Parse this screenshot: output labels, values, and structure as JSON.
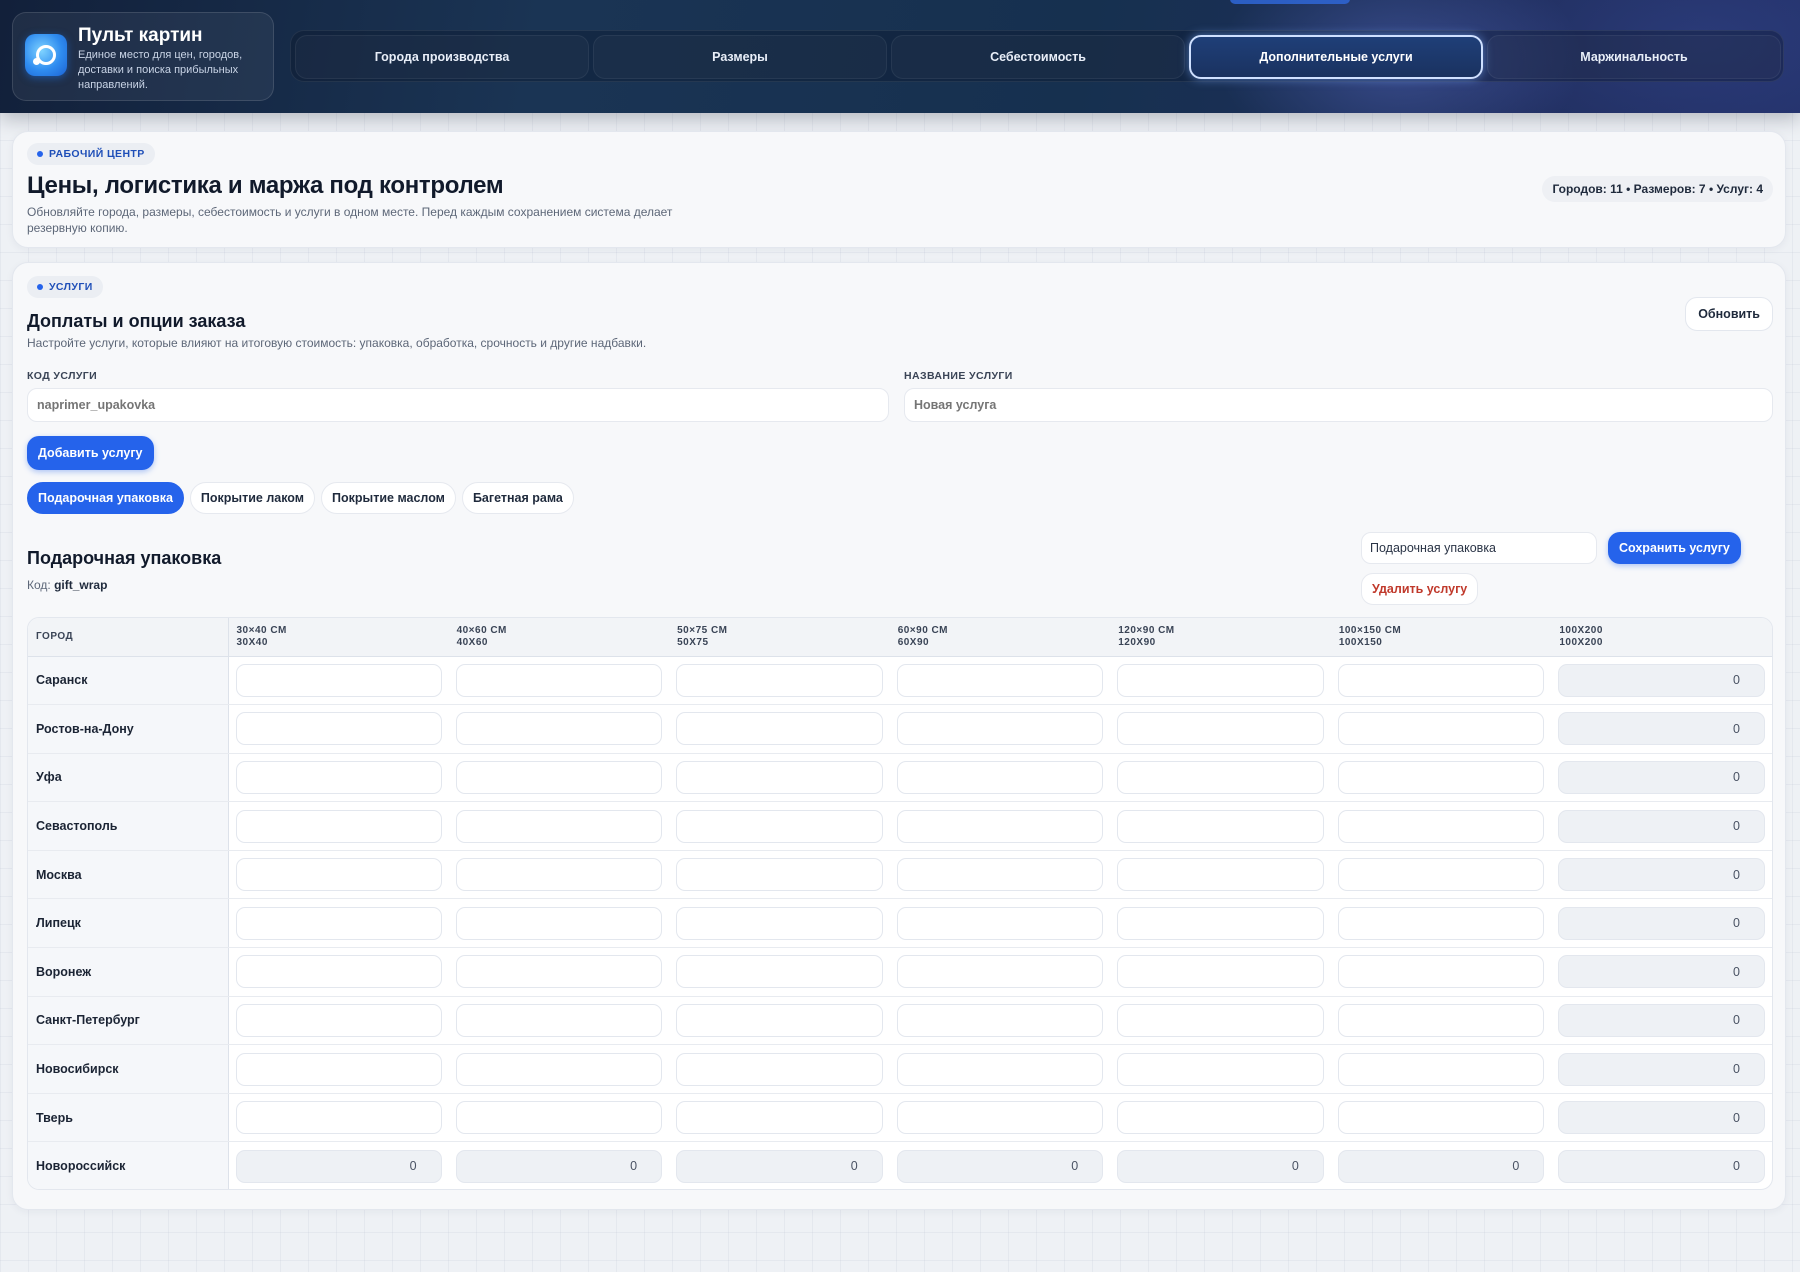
{
  "app": {
    "title": "Пульт картин",
    "subtitle": "Единое место для цен, городов, доставки и поиска прибыльных направлений."
  },
  "nav": {
    "tabs": [
      {
        "label": "Города производства",
        "active": false
      },
      {
        "label": "Размеры",
        "active": false
      },
      {
        "label": "Себестоимость",
        "active": false
      },
      {
        "label": "Дополнительные услуги",
        "active": true
      },
      {
        "label": "Маржинальность",
        "active": false
      }
    ]
  },
  "hero": {
    "tag": "РАБОЧИЙ ЦЕНТР",
    "title": "Цены, логистика и маржа под контролем",
    "description": "Обновляйте города, размеры, себестоимость и услуги в одном месте. Перед каждым сохранением система делает резервную копию.",
    "stats": "Городов: 11 • Размеров: 7 • Услуг: 4"
  },
  "services": {
    "tag": "УСЛУГИ",
    "title": "Доплаты и опции заказа",
    "description": "Настройте услуги, которые влияют на итоговую стоимость: упаковка, обработка, срочность и другие надбавки.",
    "refresh_label": "Обновить",
    "code_label": "КОД УСЛУГИ",
    "code_placeholder": "naprimer_upakovka",
    "name_label": "НАЗВАНИЕ УСЛУГИ",
    "name_placeholder": "Новая услуга",
    "add_label": "Добавить услугу",
    "tabs": [
      "Подарочная упаковка",
      "Покрытие лаком",
      "Покрытие маслом",
      "Багетная рама"
    ],
    "active_tab": 0
  },
  "selected": {
    "name": "Подарочная упаковка",
    "code_prefix": "Код:",
    "code": "gift_wrap",
    "edit_value": "Подарочная упаковка",
    "save_label": "Сохранить услугу",
    "delete_label": "Удалить услугу"
  },
  "table": {
    "city_header": "ГОРОД",
    "sizes": [
      {
        "label": "30×40 СМ",
        "code": "30X40"
      },
      {
        "label": "40×60 СМ",
        "code": "40X60"
      },
      {
        "label": "50×75 СМ",
        "code": "50X75"
      },
      {
        "label": "60×90 СМ",
        "code": "60X90"
      },
      {
        "label": "120×90 СМ",
        "code": "120X90"
      },
      {
        "label": "100×150 СМ",
        "code": "100X150"
      },
      {
        "label": "100X200",
        "code": "100X200"
      }
    ],
    "rows": [
      {
        "city": "Саранск",
        "values": [
          "",
          "",
          "",
          "",
          "",
          "",
          "0"
        ]
      },
      {
        "city": "Ростов-на-Дону",
        "values": [
          "",
          "",
          "",
          "",
          "",
          "",
          "0"
        ]
      },
      {
        "city": "Уфа",
        "values": [
          "",
          "",
          "",
          "",
          "",
          "",
          "0"
        ]
      },
      {
        "city": "Севастополь",
        "values": [
          "",
          "",
          "",
          "",
          "",
          "",
          "0"
        ]
      },
      {
        "city": "Москва",
        "values": [
          "",
          "",
          "",
          "",
          "",
          "",
          "0"
        ]
      },
      {
        "city": "Липецк",
        "values": [
          "",
          "",
          "",
          "",
          "",
          "",
          "0"
        ]
      },
      {
        "city": "Воронеж",
        "values": [
          "",
          "",
          "",
          "",
          "",
          "",
          "0"
        ]
      },
      {
        "city": "Санкт-Петербург",
        "values": [
          "",
          "",
          "",
          "",
          "",
          "",
          "0"
        ]
      },
      {
        "city": "Новосибирск",
        "values": [
          "",
          "",
          "",
          "",
          "",
          "",
          "0"
        ]
      },
      {
        "city": "Тверь",
        "values": [
          "",
          "",
          "",
          "",
          "",
          "",
          "0"
        ]
      },
      {
        "city": "Новороссийск",
        "values": [
          "0",
          "0",
          "0",
          "0",
          "0",
          "0",
          "0"
        ]
      }
    ]
  },
  "colors": {
    "accent": "#2563eb",
    "danger": "#c0392b",
    "header_bg": "#16304f"
  }
}
